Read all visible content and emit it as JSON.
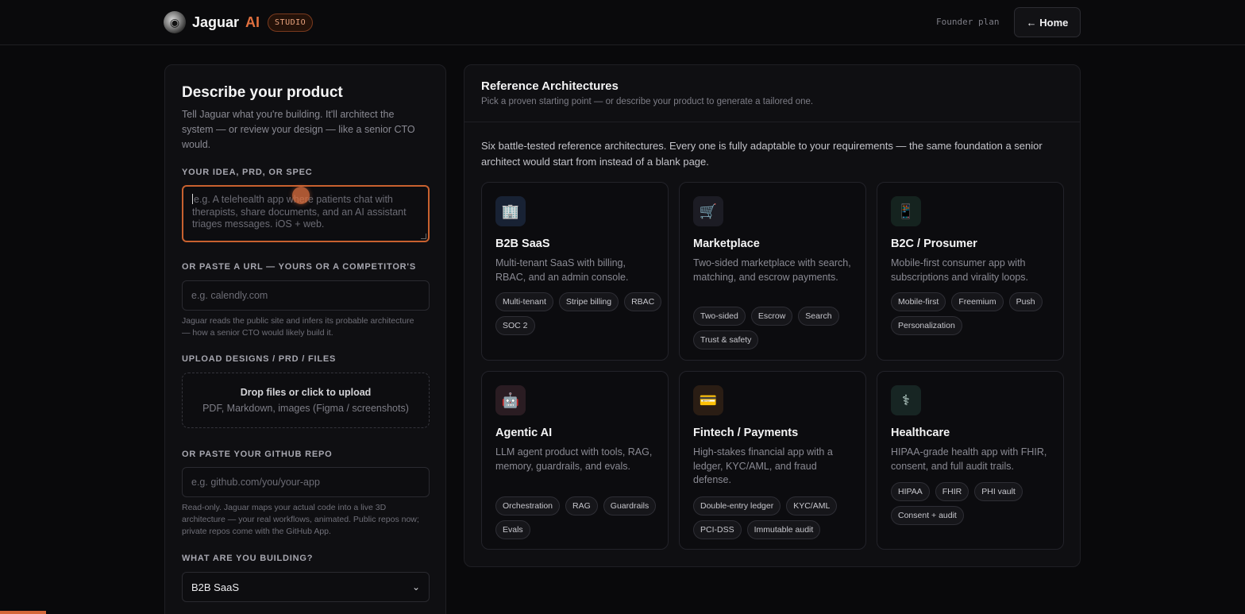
{
  "header": {
    "brand": "Jaguar",
    "brand_ai": "AI",
    "badge": "STUDIO",
    "plan": "Founder plan",
    "home_button": "← Home"
  },
  "left": {
    "title": "Describe your product",
    "lead": "Tell Jaguar what you're building. It'll architect the system — or review your design — like a senior CTO would.",
    "idea_label": "YOUR IDEA, PRD, OR SPEC",
    "idea_placeholder": "e.g. A telehealth app where patients chat with therapists, share documents, and an AI assistant triages messages. iOS + web.",
    "url_label": "OR PASTE A URL — YOURS OR A COMPETITOR'S",
    "url_placeholder": "e.g. calendly.com",
    "url_help": "Jaguar reads the public site and infers its probable architecture — how a senior CTO would likely build it.",
    "upload_label": "UPLOAD DESIGNS / PRD / FILES",
    "upload_title": "Drop files or click to upload",
    "upload_sub": "PDF, Markdown, images (Figma / screenshots)",
    "repo_label": "OR PASTE YOUR GITHUB REPO",
    "repo_placeholder": "e.g. github.com/you/your-app",
    "repo_help": "Read-only. Jaguar maps your actual code into a live 3D architecture — your real workflows, animated. Public repos now; private repos come with the GitHub App.",
    "building_label": "WHAT ARE YOU BUILDING?",
    "building_value": "B2B SaaS"
  },
  "right": {
    "title": "Reference Architectures",
    "subtitle": "Pick a proven starting point — or describe your product to generate a tailored one.",
    "description": "Six battle-tested reference architectures. Every one is fully adaptable to your requirements — the same foundation a senior architect would start from instead of a blank page.",
    "cards": [
      {
        "icon": "🏢",
        "title": "B2B SaaS",
        "desc": "Multi-tenant SaaS with billing, RBAC, and an admin console.",
        "tags": [
          "Multi-tenant",
          "Stripe billing",
          "RBAC",
          "SOC 2"
        ]
      },
      {
        "icon": "🛒",
        "title": "Marketplace",
        "desc": "Two-sided marketplace with search, matching, and escrow payments.",
        "tags": [
          "Two-sided",
          "Escrow",
          "Search",
          "Trust & safety"
        ]
      },
      {
        "icon": "📱",
        "title": "B2C / Prosumer",
        "desc": "Mobile-first consumer app with subscriptions and virality loops.",
        "tags": [
          "Mobile-first",
          "Freemium",
          "Push",
          "Personalization"
        ]
      },
      {
        "icon": "🤖",
        "title": "Agentic AI",
        "desc": "LLM agent product with tools, RAG, memory, guardrails, and evals.",
        "tags": [
          "Orchestration",
          "RAG",
          "Guardrails",
          "Evals"
        ]
      },
      {
        "icon": "💳",
        "title": "Fintech / Payments",
        "desc": "High-stakes financial app with a ledger, KYC/AML, and fraud defense.",
        "tags": [
          "Double-entry ledger",
          "KYC/AML",
          "PCI-DSS",
          "Immutable audit"
        ]
      },
      {
        "icon": "⚕",
        "title": "Healthcare",
        "desc": "HIPAA-grade health app with FHIR, consent, and full audit trails.",
        "tags": [
          "HIPAA",
          "FHIR",
          "PHI vault",
          "Consent + audit"
        ]
      }
    ]
  },
  "colors": {
    "accent": "#e0703f",
    "background": "#09090b",
    "panel": "#0f0f12"
  }
}
